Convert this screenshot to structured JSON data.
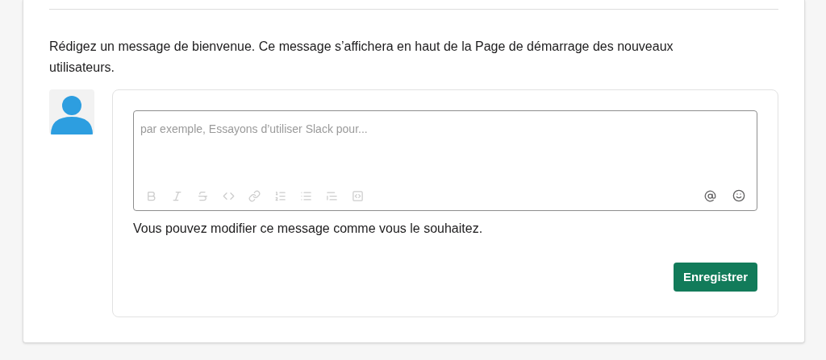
{
  "description": "Rédigez un message de bienvenue. Ce message s’affichera en haut de la Page de démarrage des nouveaux utilisateurs.",
  "composer": {
    "placeholder": "par exemple, Essayons d’utiliser Slack pour...",
    "formatting_disabled": true
  },
  "helper_text": "Vous pouvez modifier ce message comme vous le souhaitez.",
  "save_button": {
    "label": "Enregistrer"
  }
}
